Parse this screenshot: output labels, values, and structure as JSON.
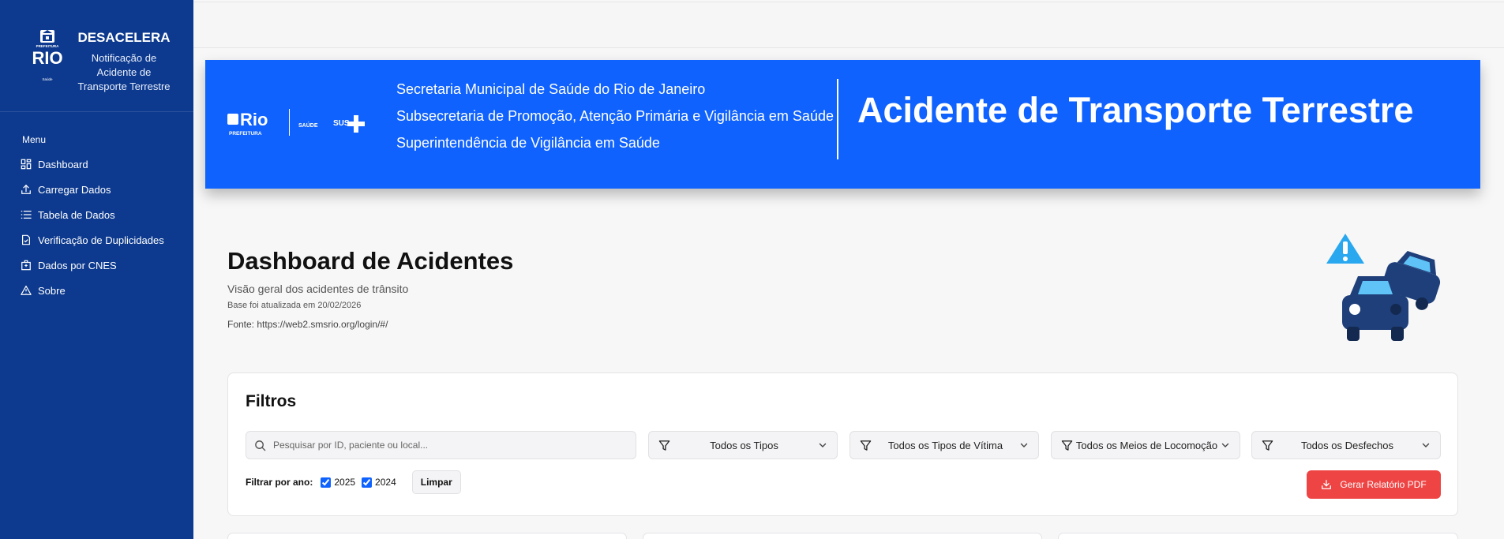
{
  "sidebar": {
    "logo_text": "PREFEITURA RIO Saúde",
    "app_title": "DESACELERA",
    "app_subtitle": "Notificação de Acidente de Transporte Terrestre",
    "menu_label": "Menu",
    "items": [
      {
        "label": "Dashboard",
        "icon": "layout-grid-icon"
      },
      {
        "label": "Carregar Dados",
        "icon": "upload-icon"
      },
      {
        "label": "Tabela de Dados",
        "icon": "list-icon"
      },
      {
        "label": "Verificação de Duplicidades",
        "icon": "file-check-icon"
      },
      {
        "label": "Dados por CNES",
        "icon": "hospital-icon"
      },
      {
        "label": "Sobre",
        "icon": "alert-triangle-icon"
      }
    ]
  },
  "banner": {
    "logos_text": "Rio PREFEITURA SAÚDE SUS",
    "lines": [
      "Secretaria Municipal de Saúde do Rio de Janeiro",
      "Subsecretaria de Promoção, Atenção Primária e Vigilância em Saúde",
      "Superintendência de Vigilância em Saúde"
    ],
    "title": "Acidente de Transporte Terrestre"
  },
  "page": {
    "title": "Dashboard de Acidentes",
    "subtitle": "Visão geral dos acidentes de trânsito",
    "updated": "Base foi atualizada em 20/02/2026",
    "source": "Fonte: https://web2.smsrio.org/login/#/"
  },
  "filters": {
    "title": "Filtros",
    "search_placeholder": "Pesquisar por ID, paciente ou local...",
    "selects": [
      "Todos os Tipos",
      "Todos os Tipos de Vítima",
      "Todos os Meios de Locomoção",
      "Todos os Desfechos"
    ],
    "year_label": "Filtrar por ano:",
    "years": [
      {
        "label": "2025",
        "checked": true
      },
      {
        "label": "2024",
        "checked": true
      }
    ],
    "clear_label": "Limpar",
    "pdf_label": "Gerar Relatório PDF"
  },
  "colors": {
    "sidebar": "#0d3a8e",
    "banner": "#0f62fe",
    "pdf_button": "#ef4444"
  }
}
